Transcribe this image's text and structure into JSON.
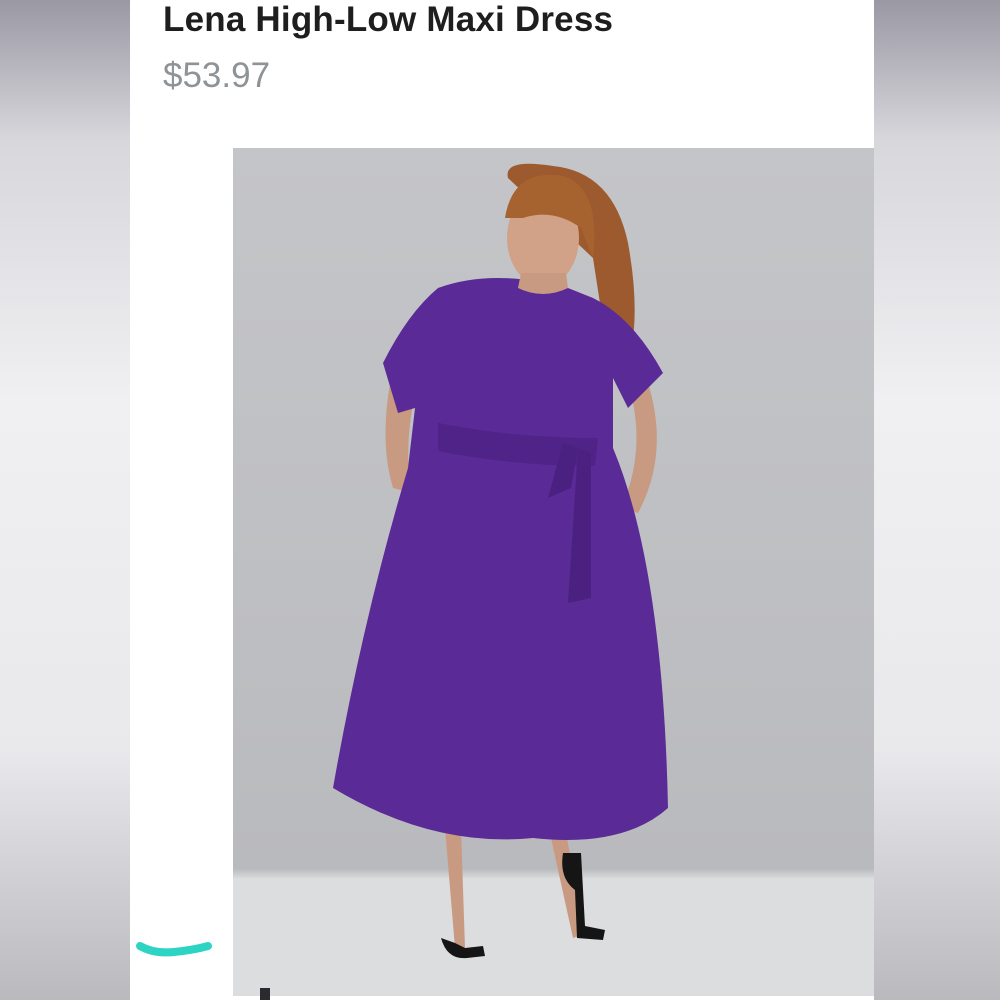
{
  "product": {
    "title": "Lena High-Low Maxi Dress",
    "price": "$53.97"
  },
  "colors": {
    "dress": "#5a2a96",
    "backdrop": "#bfc0c3",
    "floor": "#dedfe0",
    "accent_mark": "#2dd4c4"
  },
  "icons": {
    "scroll_mark": "teal-squiggle-mark"
  }
}
